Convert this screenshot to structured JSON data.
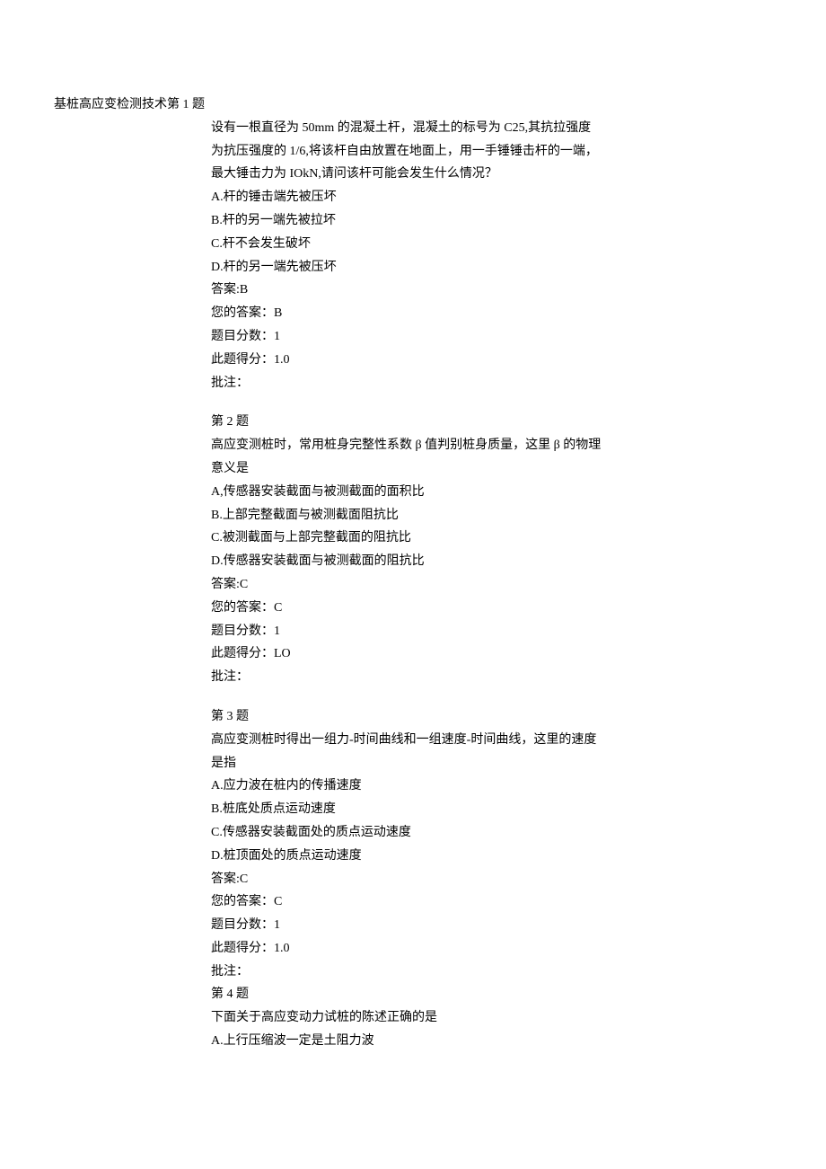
{
  "header": {
    "title_prefix": "基桩高应变检测技术",
    "first_q_label": "第 1 题"
  },
  "questions": [
    {
      "label": "",
      "stem": [
        "设有一根直径为 50mm 的混凝土杆，混凝土的标号为 C25,其抗拉强度",
        "为抗压强度的 1/6,将该杆自由放置在地面上，用一手锤锤击杆的一端，",
        "最大锤击力为 IOkN,请问该杆可能会发生什么情况？"
      ],
      "options": [
        "A.杆的锤击端先被压坏",
        "B.杆的另一端先被拉坏",
        "C.杆不会发生破坏",
        "D.杆的另一端先被压坏"
      ],
      "answer_label": "答案:B",
      "your_answer": "您的答案：B",
      "score_label": "题目分数：1",
      "earned_label": "此题得分：1.0",
      "note_label": "批注："
    },
    {
      "label": "第 2 题",
      "stem": [
        "高应变测桩时，常用桩身完整性系数 β 值判别桩身质量，这里 β 的物理",
        "意义是"
      ],
      "options": [
        "A,传感器安装截面与被测截面的面积比",
        "B.上部完整截面与被测截面阻抗比",
        "C.被测截面与上部完整截面的阻抗比",
        "D.传感器安装截面与被测截面的阻抗比"
      ],
      "answer_label": "答案:C",
      "your_answer": "您的答案：C",
      "score_label": "题目分数：1",
      "earned_label": "此题得分：LO",
      "note_label": "批注："
    },
    {
      "label": "第 3 题",
      "stem": [
        "高应变测桩时得出一组力-时间曲线和一组速度-时间曲线，这里的速度",
        "是指"
      ],
      "options": [
        "A.应力波在桩内的传播速度",
        "B.桩底处质点运动速度",
        "C.传感器安装截面处的质点运动速度",
        "D.桩顶面处的质点运动速度"
      ],
      "answer_label": "答案:C",
      "your_answer": "您的答案：C",
      "score_label": "题目分数：1",
      "earned_label": "此题得分：1.0",
      "note_label": "批注："
    },
    {
      "label": "第 4 题",
      "stem": [
        "下面关于高应变动力试桩的陈述正确的是"
      ],
      "options": [
        "A.上行压缩波一定是土阻力波"
      ],
      "answer_label": "",
      "your_answer": "",
      "score_label": "",
      "earned_label": "",
      "note_label": ""
    }
  ]
}
